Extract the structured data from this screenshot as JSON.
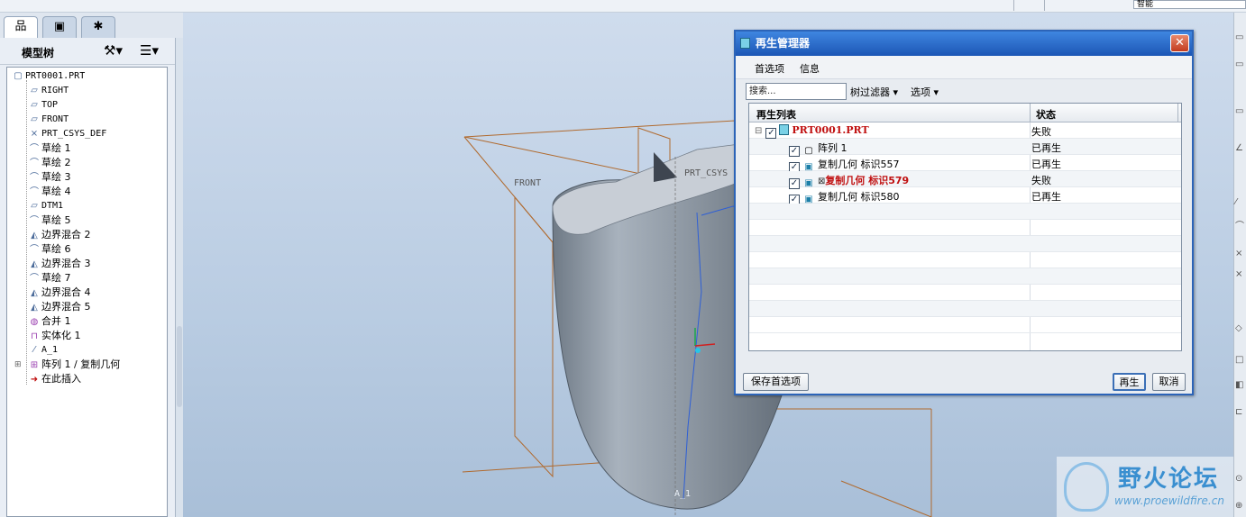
{
  "topbar": {
    "combo_value": "智能"
  },
  "left_tabs": [
    {
      "icon": "model-tree-tab-icon",
      "glyph": "品"
    },
    {
      "icon": "folder-tab-icon",
      "glyph": "▣"
    },
    {
      "icon": "favorites-tab-icon",
      "glyph": "✱"
    }
  ],
  "model_tree": {
    "title": "模型树",
    "items": [
      {
        "label": "PRT0001.PRT",
        "icon": "part-icon",
        "glyph": "▢"
      },
      {
        "label": "RIGHT",
        "icon": "datum-plane-icon",
        "glyph": "▱"
      },
      {
        "label": "TOP",
        "icon": "datum-plane-icon",
        "glyph": "▱"
      },
      {
        "label": "FRONT",
        "icon": "datum-plane-icon",
        "glyph": "▱"
      },
      {
        "label": "PRT_CSYS_DEF",
        "icon": "csys-icon",
        "glyph": "⨯"
      },
      {
        "label": "草绘 1",
        "icon": "sketch-icon",
        "glyph": "⌒"
      },
      {
        "label": "草绘 2",
        "icon": "sketch-icon",
        "glyph": "⌒"
      },
      {
        "label": "草绘 3",
        "icon": "sketch-icon",
        "glyph": "⌒"
      },
      {
        "label": "草绘 4",
        "icon": "sketch-icon",
        "glyph": "⌒"
      },
      {
        "label": "DTM1",
        "icon": "datum-plane-icon",
        "glyph": "▱"
      },
      {
        "label": "草绘 5",
        "icon": "sketch-icon",
        "glyph": "⌒"
      },
      {
        "label": "边界混合 2",
        "icon": "boundary-blend-icon",
        "glyph": "◭"
      },
      {
        "label": "草绘 6",
        "icon": "sketch-icon",
        "glyph": "⌒"
      },
      {
        "label": "边界混合 3",
        "icon": "boundary-blend-icon",
        "glyph": "◭"
      },
      {
        "label": "草绘 7",
        "icon": "sketch-icon",
        "glyph": "⌒"
      },
      {
        "label": "边界混合 4",
        "icon": "boundary-blend-icon",
        "glyph": "◭"
      },
      {
        "label": "边界混合 5",
        "icon": "boundary-blend-icon",
        "glyph": "◭"
      },
      {
        "label": "合并 1",
        "icon": "merge-icon",
        "glyph": "◍"
      },
      {
        "label": "实体化 1",
        "icon": "solidify-icon",
        "glyph": "⊓"
      },
      {
        "label": "A_1",
        "icon": "axis-icon",
        "glyph": "⁄"
      },
      {
        "label": "阵列 1 / 复制几何",
        "icon": "pattern-icon",
        "glyph": "⊞"
      },
      {
        "label": "在此插入",
        "icon": "insert-arrow-icon",
        "glyph": "➜"
      }
    ]
  },
  "viewport": {
    "labels": {
      "front": "FRONT",
      "csys": "PRT_CSYS",
      "axis": "A_1"
    },
    "colors": {
      "datum": "#b06a2e",
      "axis": "#2e5fd6"
    }
  },
  "dialog": {
    "title": "再生管理器",
    "menu": [
      "首选项",
      "信息"
    ],
    "search_placeholder": "搜索...",
    "tree_filter": "树过滤器",
    "options": "选项",
    "columns": [
      "再生列表",
      "状态"
    ],
    "rows": [
      {
        "name": "PRT0001.PRT",
        "status": "失败",
        "indent": 0,
        "red": true,
        "icon": "part-icon",
        "expander": "⊟"
      },
      {
        "name": "阵列 1",
        "status": "已再生",
        "indent": 1,
        "red": false,
        "icon": "pattern-icon"
      },
      {
        "name": "复制几何 标识557",
        "status": "已再生",
        "indent": 1,
        "red": false,
        "icon": "copy-geometry-icon"
      },
      {
        "name": "复制几何 标识579",
        "status": "失败",
        "indent": 1,
        "red": true,
        "icon": "copy-geometry-icon",
        "error_mark": "⊠"
      },
      {
        "name": "复制几何 标识580",
        "status": "已再生",
        "indent": 1,
        "red": false,
        "icon": "copy-geometry-icon"
      }
    ],
    "buttons": {
      "save_prefs": "保存首选项",
      "regenerate": "再生",
      "cancel": "取消"
    }
  },
  "watermark": {
    "text": "野火论坛",
    "url": "www.proewildfire.cn"
  }
}
